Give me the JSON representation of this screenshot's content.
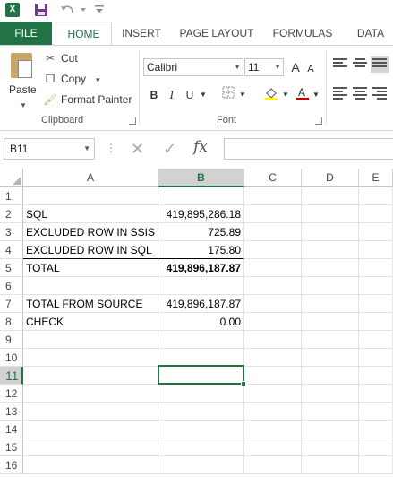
{
  "qat": {
    "logo_text": "X"
  },
  "tabs": [
    "FILE",
    "HOME",
    "INSERT",
    "PAGE LAYOUT",
    "FORMULAS",
    "DATA"
  ],
  "clipboard": {
    "paste_label": "Paste",
    "cut_label": "Cut",
    "copy_label": "Copy",
    "format_painter_label": "Format Painter",
    "group_label": "Clipboard"
  },
  "font": {
    "family_value": "Calibri",
    "size_value": "11",
    "bold": "B",
    "italic": "I",
    "underline": "U",
    "group_label": "Font",
    "grow_label": "A",
    "shrink_label": "A"
  },
  "formula_bar": {
    "name_box": "B11",
    "fx_label": "fx",
    "formula": ""
  },
  "grid": {
    "columns": [
      "A",
      "B",
      "C",
      "D",
      "E"
    ],
    "rows": [
      "1",
      "2",
      "3",
      "4",
      "5",
      "6",
      "7",
      "8",
      "9",
      "10",
      "11",
      "12",
      "13",
      "14",
      "15",
      "16"
    ],
    "cells": {
      "a2": "SQL",
      "b2": "419,895,286.18",
      "a3": "EXCLUDED ROW IN SSIS",
      "b3": "725.89",
      "a4": "EXCLUDED ROW IN SQL",
      "b4": "175.80",
      "a5": "TOTAL",
      "b5": "419,896,187.87",
      "a7": "TOTAL FROM SOURCE",
      "b7": "419,896,187.87",
      "a8": "CHECK",
      "b8": "0.00"
    },
    "selected_cell": "B11"
  },
  "colors": {
    "accent": "#217346",
    "header_selected": "#d2d2d2",
    "font_color_bar": "#c00000",
    "highlight_bar": "#ffff00"
  }
}
